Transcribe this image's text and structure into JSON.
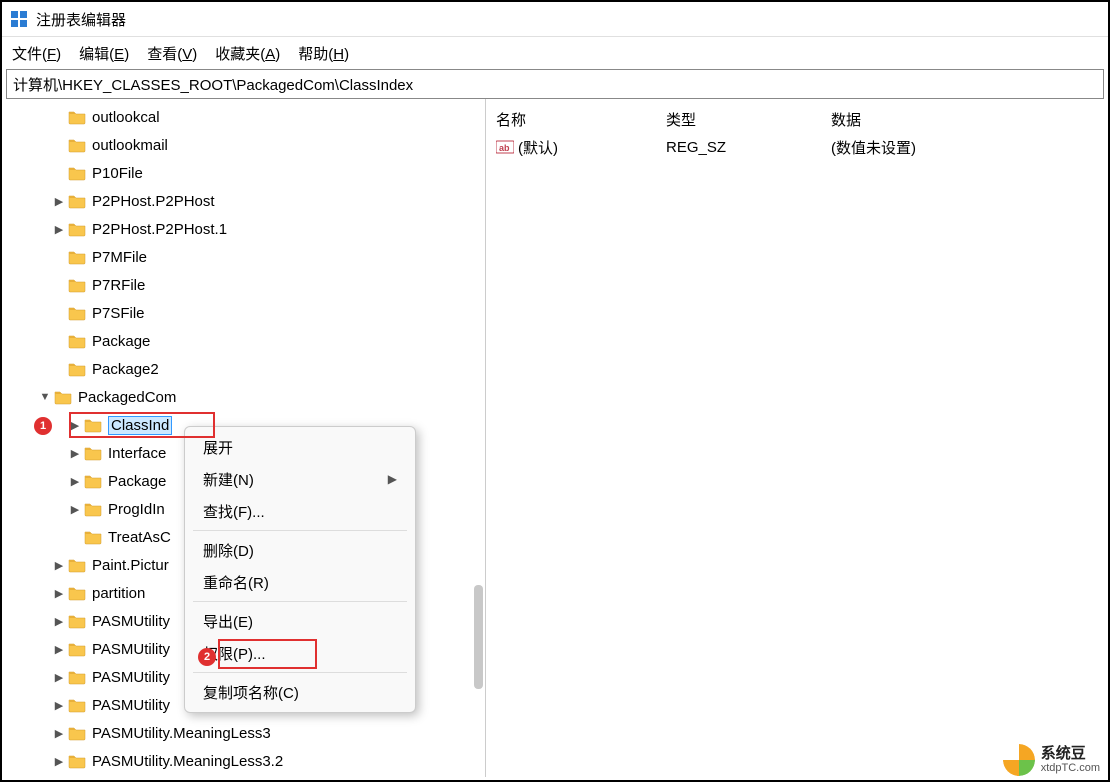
{
  "window": {
    "title": "注册表编辑器"
  },
  "menu": {
    "file": "文件(",
    "file_u": "F",
    "file_end": ")",
    "edit": "编辑(",
    "edit_u": "E",
    "edit_end": ")",
    "view": "查看(",
    "view_u": "V",
    "view_end": ")",
    "fav": "收藏夹(",
    "fav_u": "A",
    "fav_end": ")",
    "help": "帮助(",
    "help_u": "H",
    "help_end": ")"
  },
  "path": "计算机\\HKEY_CLASSES_ROOT\\PackagedCom\\ClassIndex",
  "tree": [
    {
      "indent": 50,
      "expander": "",
      "label": "outlookcal"
    },
    {
      "indent": 50,
      "expander": "",
      "label": "outlookmail"
    },
    {
      "indent": 50,
      "expander": "",
      "label": "P10File"
    },
    {
      "indent": 50,
      "expander": ">",
      "label": "P2PHost.P2PHost"
    },
    {
      "indent": 50,
      "expander": ">",
      "label": "P2PHost.P2PHost.1"
    },
    {
      "indent": 50,
      "expander": "",
      "label": "P7MFile"
    },
    {
      "indent": 50,
      "expander": "",
      "label": "P7RFile"
    },
    {
      "indent": 50,
      "expander": "",
      "label": "P7SFile"
    },
    {
      "indent": 50,
      "expander": "",
      "label": "Package"
    },
    {
      "indent": 50,
      "expander": "",
      "label": "Package2"
    },
    {
      "indent": 36,
      "expander": "v",
      "label": "PackagedCom"
    },
    {
      "indent": 66,
      "expander": ">",
      "label": "ClassInd",
      "selected": true
    },
    {
      "indent": 66,
      "expander": ">",
      "label": "Interface"
    },
    {
      "indent": 66,
      "expander": ">",
      "label": "Package"
    },
    {
      "indent": 66,
      "expander": ">",
      "label": "ProgIdIn"
    },
    {
      "indent": 66,
      "expander": "",
      "label": "TreatAsC"
    },
    {
      "indent": 50,
      "expander": ">",
      "label": "Paint.Pictur"
    },
    {
      "indent": 50,
      "expander": ">",
      "label": "partition"
    },
    {
      "indent": 50,
      "expander": ">",
      "label": "PASMUtility"
    },
    {
      "indent": 50,
      "expander": ">",
      "label": "PASMUtility"
    },
    {
      "indent": 50,
      "expander": ">",
      "label": "PASMUtility"
    },
    {
      "indent": 50,
      "expander": ">",
      "label": "PASMUtility"
    },
    {
      "indent": 50,
      "expander": ">",
      "label": "PASMUtility.MeaningLess3"
    },
    {
      "indent": 50,
      "expander": ">",
      "label": "PASMUtility.MeaningLess3.2"
    }
  ],
  "list": {
    "headers": {
      "name": "名称",
      "type": "类型",
      "data": "数据"
    },
    "rows": [
      {
        "name": "(默认)",
        "type": "REG_SZ",
        "data": "(数值未设置)"
      }
    ]
  },
  "context_menu": {
    "expand": "展开",
    "new": "新建(N)",
    "find": "查找(F)...",
    "delete": "删除(D)",
    "rename": "重命名(R)",
    "export": "导出(E)",
    "permissions": "权限(P)...",
    "copy_key": "复制项名称(C)"
  },
  "watermark": {
    "title": "系统豆",
    "sub": "xtdpTC.com"
  },
  "colors": {
    "highlight": "#e03030",
    "selection": "#cce8ff",
    "folder": "#f9c64d"
  }
}
